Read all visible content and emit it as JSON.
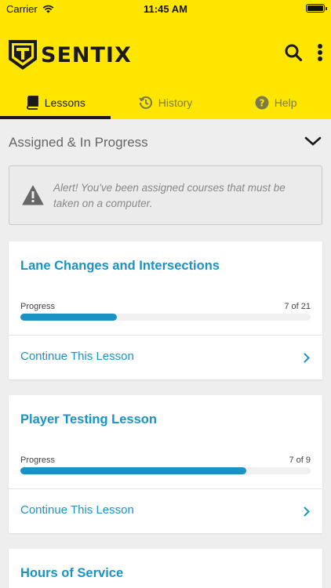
{
  "status_bar": {
    "carrier": "Carrier",
    "time": "11:45 AM"
  },
  "app": {
    "brand": "SENTIX",
    "accent_color": "#ffe600",
    "link_color": "#1a93c4"
  },
  "toolbar": {
    "search_icon": "search-icon",
    "more_icon": "more-vertical-icon"
  },
  "tabs": [
    {
      "label": "Lessons",
      "icon": "book-icon",
      "active": true
    },
    {
      "label": "History",
      "icon": "history-icon",
      "active": false
    },
    {
      "label": "Help",
      "icon": "help-icon",
      "active": false
    }
  ],
  "section": {
    "title": "Assigned & In Progress",
    "expanded": true
  },
  "alert": {
    "text": "Alert! You've been assigned courses that must be taken on a computer.",
    "icon": "warning-icon"
  },
  "lessons": [
    {
      "title": "Lane Changes and Intersections",
      "progress_label": "Progress",
      "progress_count": "7 of 21",
      "progress_fraction": 0.333,
      "action": "Continue This Lesson"
    },
    {
      "title": "Player Testing Lesson",
      "progress_label": "Progress",
      "progress_count": "7 of 9",
      "progress_fraction": 0.778,
      "action": "Continue This Lesson"
    },
    {
      "title": "Hours of Service"
    }
  ]
}
